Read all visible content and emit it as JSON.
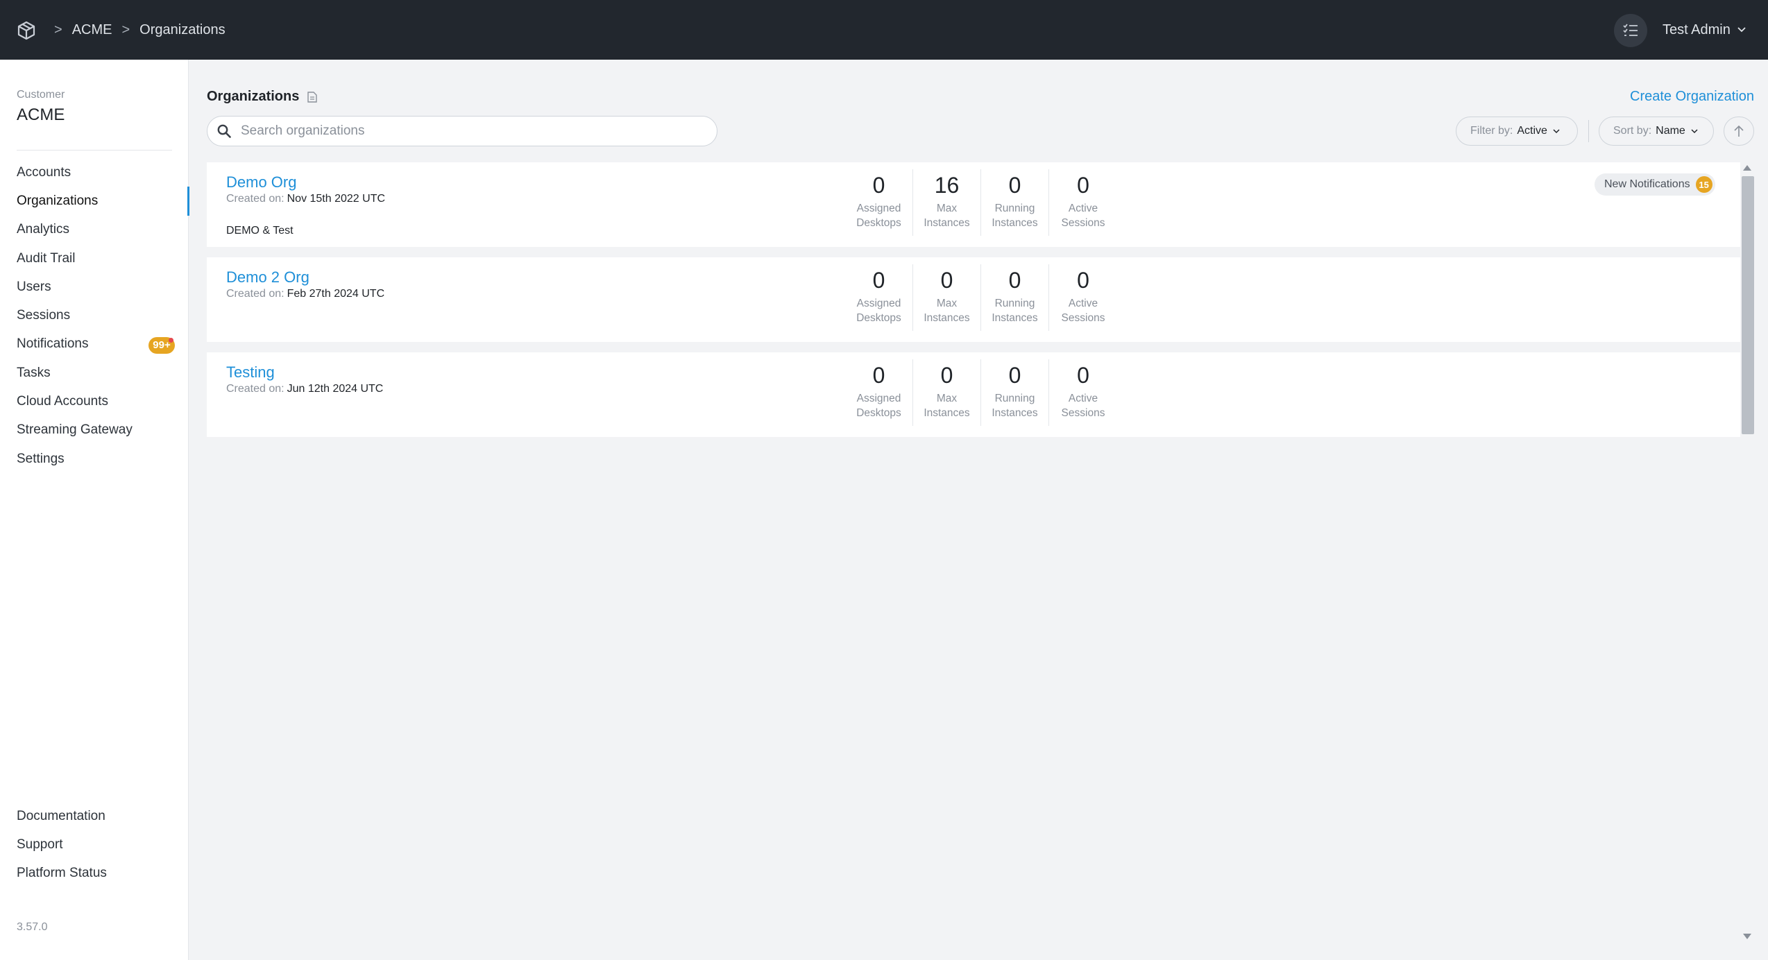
{
  "header": {
    "breadcrumbs": [
      "ACME",
      "Organizations"
    ],
    "separator": ">",
    "user_name": "Test Admin"
  },
  "sidebar": {
    "customer_label": "Customer",
    "customer_name": "ACME",
    "items": [
      {
        "label": "Accounts"
      },
      {
        "label": "Organizations",
        "active": true
      },
      {
        "label": "Analytics"
      },
      {
        "label": "Audit Trail"
      },
      {
        "label": "Users"
      },
      {
        "label": "Sessions"
      },
      {
        "label": "Notifications",
        "badge": "99+"
      },
      {
        "label": "Tasks"
      },
      {
        "label": "Cloud Accounts"
      },
      {
        "label": "Streaming Gateway"
      },
      {
        "label": "Settings"
      }
    ],
    "bottom_items": [
      {
        "label": "Documentation"
      },
      {
        "label": "Support"
      },
      {
        "label": "Platform Status"
      }
    ],
    "version": "3.57.0"
  },
  "main": {
    "title": "Organizations",
    "create_label": "Create Organization",
    "search_placeholder": "Search organizations",
    "filter": {
      "label": "Filter by:",
      "value": "Active"
    },
    "sort": {
      "label": "Sort by:",
      "value": "Name"
    },
    "stat_labels": [
      "Assigned\nDesktops",
      "Max\nInstances",
      "Running\nInstances",
      "Active\nSessions"
    ],
    "orgs": [
      {
        "name": "Demo Org",
        "created_label": "Created on:",
        "created_date": "Nov 15th 2022 UTC",
        "description": "DEMO & Test",
        "stats": [
          "0",
          "16",
          "0",
          "0"
        ],
        "notification_label": "New Notifications",
        "notification_count": "15"
      },
      {
        "name": "Demo 2 Org",
        "created_label": "Created on:",
        "created_date": "Feb 27th 2024 UTC",
        "description": "",
        "stats": [
          "0",
          "0",
          "0",
          "0"
        ]
      },
      {
        "name": "Testing",
        "created_label": "Created on:",
        "created_date": "Jun 12th 2024 UTC",
        "description": "",
        "stats": [
          "0",
          "0",
          "0",
          "0"
        ]
      }
    ]
  },
  "colors": {
    "topbar": "#22272e",
    "accent": "#1e8fd8",
    "badge": "#e6a522"
  },
  "icons": {
    "logo": "cube-logo-icon",
    "tasks": "checklist-icon",
    "search": "search-icon",
    "doc": "document-icon",
    "sort_direction": "arrow-up-icon"
  }
}
